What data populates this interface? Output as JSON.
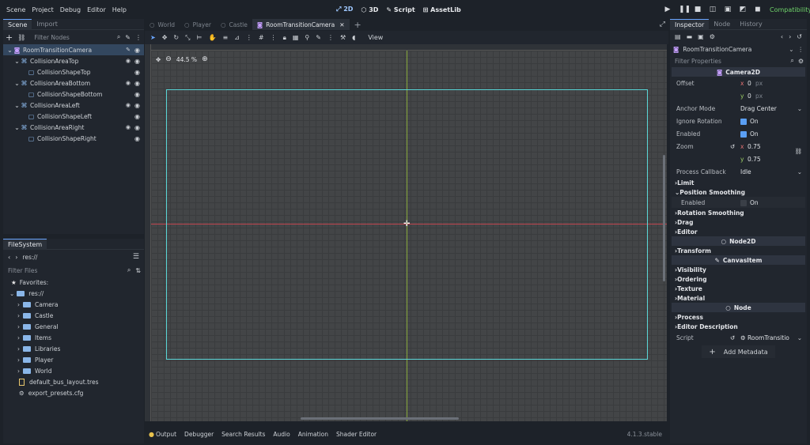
{
  "menu": [
    "Scene",
    "Project",
    "Debug",
    "Editor",
    "Help"
  ],
  "workspaces": [
    {
      "label": "2D",
      "icon": "2d-icon",
      "active": true
    },
    {
      "label": "3D",
      "icon": "3d-icon"
    },
    {
      "label": "Script",
      "icon": "script-icon"
    },
    {
      "label": "AssetLib",
      "icon": "assetlib-icon"
    }
  ],
  "renderer": "Compatibility",
  "scene_dock": {
    "tabs": [
      "Scene",
      "Import"
    ],
    "filter_placeholder": "Filter Nodes",
    "nodes": [
      {
        "label": "RoomTransitionCamera",
        "indent": 0,
        "icon": "camera2d-icon",
        "selected": true
      },
      {
        "label": "CollisionAreaTop",
        "indent": 1,
        "icon": "area2d-icon",
        "signal": true
      },
      {
        "label": "CollisionShapeTop",
        "indent": 2,
        "icon": "collisionshape-icon"
      },
      {
        "label": "CollisionAreaBottom",
        "indent": 1,
        "icon": "area2d-icon",
        "signal": true
      },
      {
        "label": "CollisionShapeBottom",
        "indent": 2,
        "icon": "collisionshape-icon"
      },
      {
        "label": "CollisionAreaLeft",
        "indent": 1,
        "icon": "area2d-icon",
        "signal": true
      },
      {
        "label": "CollisionShapeLeft",
        "indent": 2,
        "icon": "collisionshape-icon"
      },
      {
        "label": "CollisionAreaRight",
        "indent": 1,
        "icon": "area2d-icon",
        "signal": true
      },
      {
        "label": "CollisionShapeRight",
        "indent": 2,
        "icon": "collisionshape-icon"
      }
    ]
  },
  "filesystem": {
    "title": "FileSystem",
    "path": "res://",
    "filter_placeholder": "Filter Files",
    "favorites": "Favorites:",
    "root": "res://",
    "folders": [
      "Camera",
      "Castle",
      "General",
      "Items",
      "Libraries",
      "Player",
      "World"
    ],
    "files": [
      "default_bus_layout.tres",
      "export_presets.cfg"
    ]
  },
  "editor_tabs": [
    {
      "label": "World",
      "active": false
    },
    {
      "label": "Player",
      "active": false
    },
    {
      "label": "Castle",
      "active": false
    },
    {
      "label": "RoomTransitionCamera",
      "active": true
    }
  ],
  "toolbar": {
    "view_label": "View"
  },
  "viewport": {
    "zoom": "44.5 %"
  },
  "inspector": {
    "tabs": [
      "Inspector",
      "Node",
      "History"
    ],
    "node_path": "RoomTransitionCamera",
    "filter_placeholder": "Filter Properties",
    "class_camera": "Camera2D",
    "offset_label": "Offset",
    "offset_x": "0",
    "offset_y": "0",
    "px": "px",
    "anchor_label": "Anchor Mode",
    "anchor_value": "Drag Center",
    "ignore_rotation_label": "Ignore Rotation",
    "ignore_rotation_value": "On",
    "enabled_label": "Enabled",
    "enabled_value": "On",
    "zoom_label": "Zoom",
    "zoom_x": "0.75",
    "zoom_y": "0.75",
    "process_label": "Process Callback",
    "process_value": "Idle",
    "limit": "Limit",
    "pos_smoothing": "Position Smoothing",
    "ps_enabled_label": "Enabled",
    "ps_enabled_value": "On",
    "rot_smoothing": "Rotation Smoothing",
    "drag": "Drag",
    "editor": "Editor",
    "class_node2d": "Node2D",
    "transform": "Transform",
    "class_canvasitem": "CanvasItem",
    "visibility": "Visibility",
    "ordering": "Ordering",
    "texture": "Texture",
    "material": "Material",
    "class_node": "Node",
    "process": "Process",
    "editor_description": "Editor Description",
    "script_label": "Script",
    "script_value": "RoomTransitio",
    "add_metadata": "Add Metadata"
  },
  "bottom_tabs": [
    "Output",
    "Debugger",
    "Search Results",
    "Audio",
    "Animation",
    "Shader Editor"
  ],
  "version": "4.1.3.stable"
}
